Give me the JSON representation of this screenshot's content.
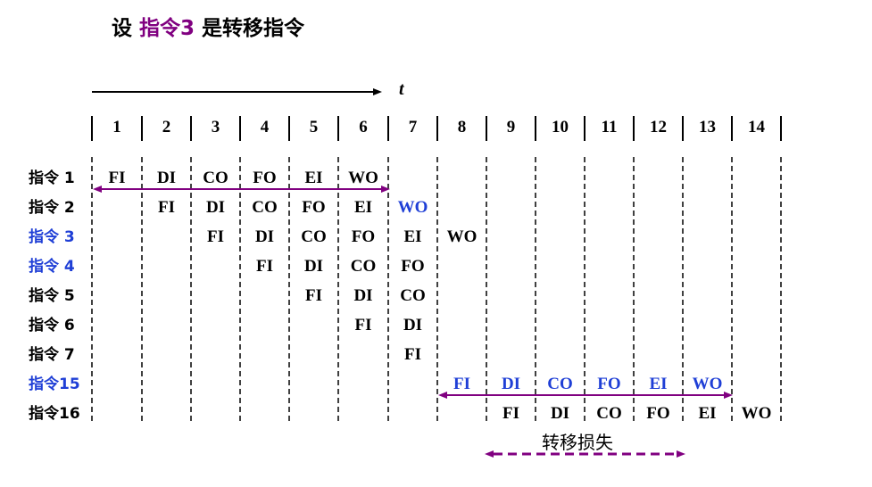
{
  "title": {
    "prefix": "设 ",
    "highlight": "指令3",
    "suffix": " 是转移指令"
  },
  "axis_label": "t",
  "columns": [
    "1",
    "2",
    "3",
    "4",
    "5",
    "6",
    "7",
    "8",
    "9",
    "10",
    "11",
    "12",
    "13",
    "14"
  ],
  "loss_label": "转移损失",
  "colors": {
    "purple": "#800080",
    "blue": "#1f3fd6",
    "black": "#000000"
  },
  "rows": [
    {
      "label": "指令 1",
      "label_color": "black",
      "start": 1,
      "stages": [
        {
          "t": "FI",
          "c": "black"
        },
        {
          "t": "DI",
          "c": "black"
        },
        {
          "t": "CO",
          "c": "black"
        },
        {
          "t": "FO",
          "c": "black"
        },
        {
          "t": "EI",
          "c": "black"
        },
        {
          "t": "WO",
          "c": "black"
        }
      ]
    },
    {
      "label": "指令 2",
      "label_color": "black",
      "start": 2,
      "stages": [
        {
          "t": "FI",
          "c": "black"
        },
        {
          "t": "DI",
          "c": "black"
        },
        {
          "t": "CO",
          "c": "black"
        },
        {
          "t": "FO",
          "c": "black"
        },
        {
          "t": "EI",
          "c": "black"
        },
        {
          "t": "WO",
          "c": "blue"
        }
      ]
    },
    {
      "label": "指令 3",
      "label_color": "blue",
      "start": 3,
      "stages": [
        {
          "t": "FI",
          "c": "black"
        },
        {
          "t": "DI",
          "c": "black"
        },
        {
          "t": "CO",
          "c": "black"
        },
        {
          "t": "FO",
          "c": "black"
        },
        {
          "t": "EI",
          "c": "black"
        },
        {
          "t": "WO",
          "c": "black"
        }
      ]
    },
    {
      "label": "指令 4",
      "label_color": "blue",
      "start": 4,
      "stages": [
        {
          "t": "FI",
          "c": "black"
        },
        {
          "t": "DI",
          "c": "black"
        },
        {
          "t": "CO",
          "c": "black"
        },
        {
          "t": "FO",
          "c": "black"
        }
      ]
    },
    {
      "label": "指令 5",
      "label_color": "black",
      "start": 5,
      "stages": [
        {
          "t": "FI",
          "c": "black"
        },
        {
          "t": "DI",
          "c": "black"
        },
        {
          "t": "CO",
          "c": "black"
        }
      ]
    },
    {
      "label": "指令 6",
      "label_color": "black",
      "start": 6,
      "stages": [
        {
          "t": "FI",
          "c": "black"
        },
        {
          "t": "DI",
          "c": "black"
        }
      ]
    },
    {
      "label": "指令 7",
      "label_color": "black",
      "start": 7,
      "stages": [
        {
          "t": "FI",
          "c": "black"
        }
      ]
    },
    {
      "label": "指令15",
      "label_color": "blue",
      "start": 8,
      "stages": [
        {
          "t": "FI",
          "c": "blue"
        },
        {
          "t": "DI",
          "c": "blue"
        },
        {
          "t": "CO",
          "c": "blue"
        },
        {
          "t": "FO",
          "c": "blue"
        },
        {
          "t": "EI",
          "c": "blue"
        },
        {
          "t": "WO",
          "c": "blue"
        }
      ]
    },
    {
      "label": "指令16",
      "label_color": "black",
      "start": 9,
      "stages": [
        {
          "t": "FI",
          "c": "black"
        },
        {
          "t": "DI",
          "c": "black"
        },
        {
          "t": "CO",
          "c": "black"
        },
        {
          "t": "FO",
          "c": "black"
        },
        {
          "t": "EI",
          "c": "black"
        },
        {
          "t": "WO",
          "c": "black"
        }
      ]
    }
  ]
}
